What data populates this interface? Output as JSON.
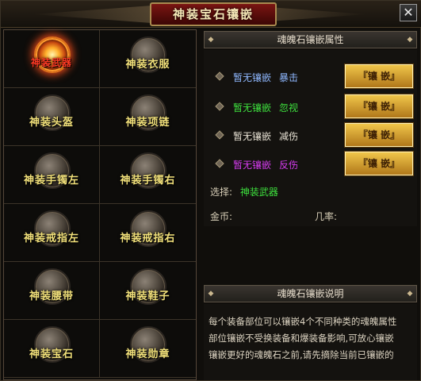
{
  "window": {
    "title": "神装宝石镶嵌",
    "close_glyph": "✕"
  },
  "slots": [
    {
      "label": "神装武器",
      "active": true
    },
    {
      "label": "神装衣服",
      "active": false
    },
    {
      "label": "神装头盔",
      "active": false
    },
    {
      "label": "神装项链",
      "active": false
    },
    {
      "label": "神装手镯左",
      "active": false
    },
    {
      "label": "神装手镯右",
      "active": false
    },
    {
      "label": "神装戒指左",
      "active": false
    },
    {
      "label": "神装戒指右",
      "active": false
    },
    {
      "label": "神装腰带",
      "active": false
    },
    {
      "label": "神装鞋子",
      "active": false
    },
    {
      "label": "神装宝石",
      "active": false
    },
    {
      "label": "神装勋章",
      "active": false
    }
  ],
  "attributes": {
    "header": "魂魄石镶嵌属性",
    "rows": [
      {
        "status": "暂无镶嵌",
        "name": "暴击",
        "color": "#8fb8ff",
        "button": "『镶 嵌』"
      },
      {
        "status": "暂无镶嵌",
        "name": "忽视",
        "color": "#3ee23e",
        "button": "『镶 嵌』"
      },
      {
        "status": "暂无镶嵌",
        "name": "减伤",
        "color": "#e8e2d4",
        "button": "『镶 嵌』"
      },
      {
        "status": "暂无镶嵌",
        "name": "反伤",
        "color": "#d63cf0",
        "button": "『镶 嵌』"
      }
    ],
    "select_label": "选择:",
    "select_value": "神装武器",
    "gold_label": "金币:",
    "rate_label": "几率:"
  },
  "description": {
    "header": "魂魄石镶嵌说明",
    "lines": [
      "每个装备部位可以镶嵌4个不同种类的魂魄属性",
      "部位镶嵌不受换装备和爆装备影响,可放心镶嵌",
      "镶嵌更好的魂魄石之前,请先摘除当前已镶嵌的"
    ]
  },
  "colors": {
    "select_label": "#d8cfb8",
    "select_value": "#3ee23e",
    "slot_label": "#f1e07a",
    "slot_label_active": "#ff3a24"
  }
}
